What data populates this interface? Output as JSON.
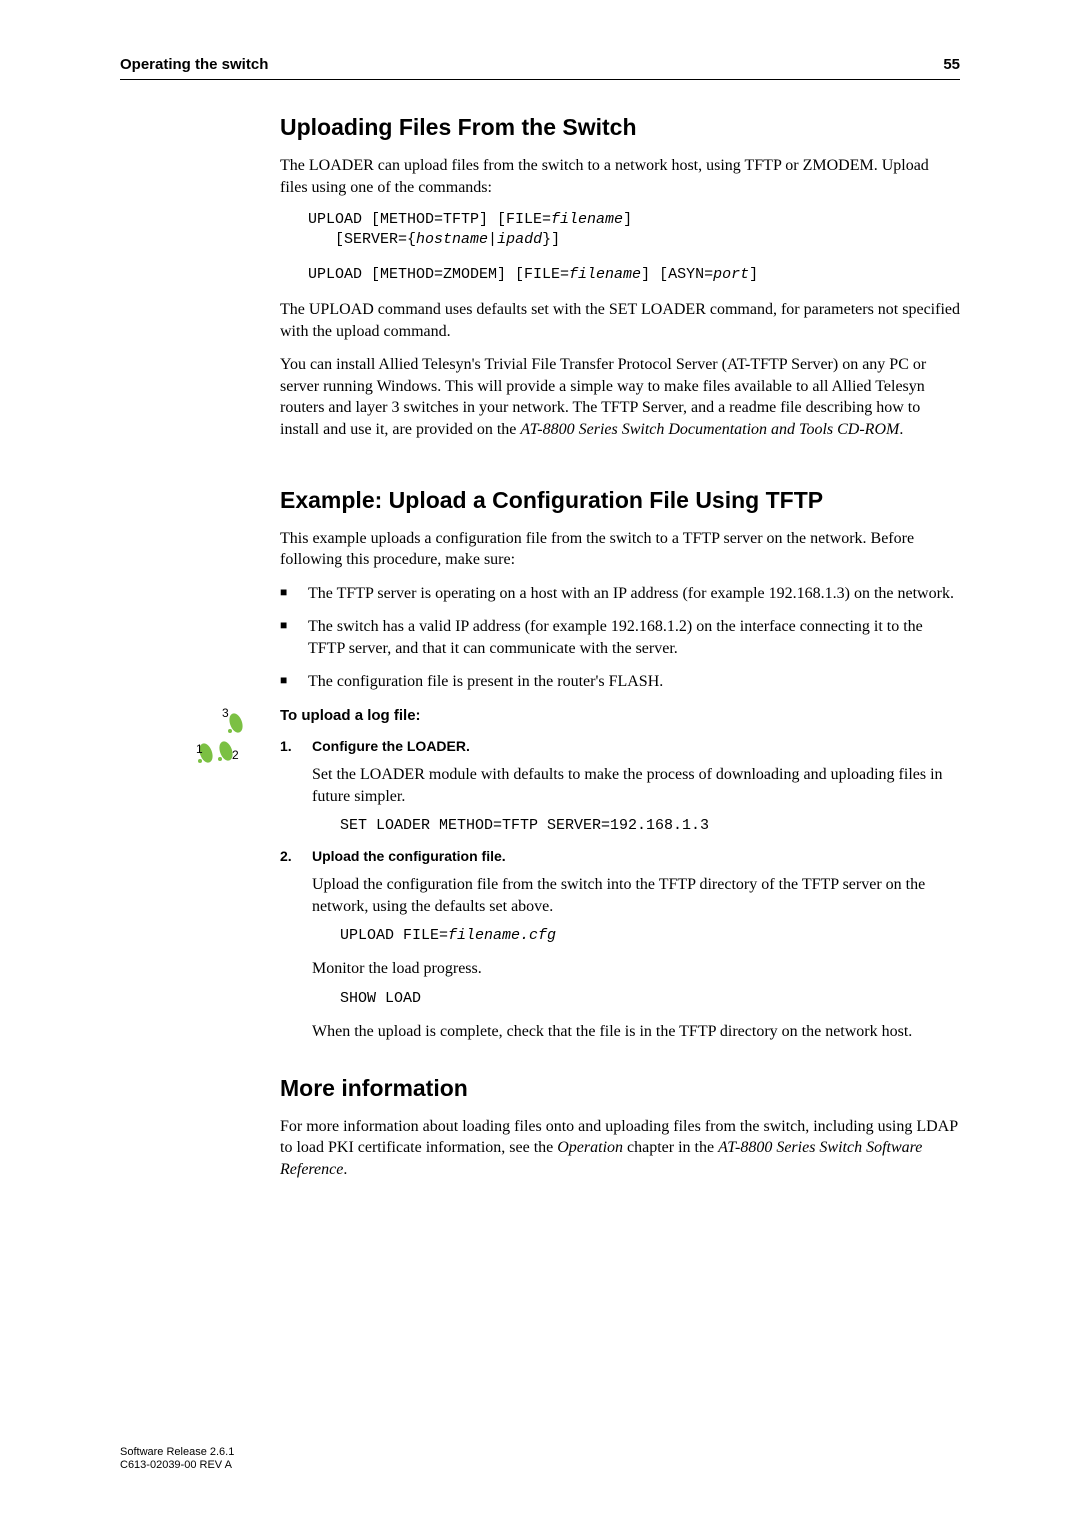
{
  "header": {
    "title": "Operating the switch",
    "page_number": "55"
  },
  "section1": {
    "heading": "Uploading Files From the Switch",
    "para1": "The LOADER can upload files from the switch to a network host, using TFTP or ZMODEM. Upload files using one of the commands:",
    "code1_a": "UPLOAD [METHOD=TFTP] [FILE=",
    "code1_b": "filename",
    "code1_c": "] \n   [SERVER={",
    "code1_d": "hostname",
    "code1_e": "|",
    "code1_f": "ipadd",
    "code1_g": "}]",
    "code2_a": "UPLOAD [METHOD=ZMODEM] [FILE=",
    "code2_b": "filename",
    "code2_c": "] [ASYN=",
    "code2_d": "port",
    "code2_e": "]",
    "para2": "The UPLOAD command uses defaults set with the SET LOADER command, for parameters not specified with the upload command.",
    "para3_a": "You can install Allied Telesyn's Trivial File Transfer Protocol Server (AT-TFTP Server) on any PC or server running Windows. This will provide a simple way to make files available to all Allied Telesyn routers and layer 3 switches in your network. The TFTP Server, and a readme file describing how to install and use it, are provided on the ",
    "para3_b": "AT-8800 Series Switch Documentation and Tools CD-ROM",
    "para3_c": "."
  },
  "section2": {
    "heading": "Example: Upload a Configuration File Using TFTP",
    "para1": "This example uploads a configuration file from the switch to a TFTP server on the network. Before following this procedure, make sure:",
    "bullets": [
      "The TFTP server is operating on a host with an IP address (for example 192.168.1.3) on the network.",
      "The switch has a valid IP address (for example 192.168.1.2) on the interface connecting it to the TFTP server, and that it can communicate with the server.",
      "The configuration file is present in the router's FLASH."
    ],
    "proc_title": "To upload a log file:",
    "step1": {
      "title": "Configure the LOADER.",
      "body": "Set the LOADER module with defaults to make the process of downloading and uploading files in future simpler.",
      "code": "SET LOADER METHOD=TFTP SERVER=192.168.1.3"
    },
    "step2": {
      "title": "Upload the configuration file.",
      "body1": "Upload the configuration file from the switch into the TFTP directory of the TFTP server on the network, using the defaults set above.",
      "code1_a": "UPLOAD FILE=",
      "code1_b": "filename.cfg",
      "body2": "Monitor the load progress.",
      "code2": "SHOW LOAD",
      "body3": "When the upload is complete, check that the file is in the TFTP directory on the network host."
    }
  },
  "section3": {
    "heading": "More information",
    "para_a": "For more information about loading files onto and uploading files from the switch, including using LDAP to load PKI certificate information, see the ",
    "para_b": "Operation",
    "para_c": " chapter in the ",
    "para_d": "AT-8800 Series Switch Software Reference",
    "para_e": "."
  },
  "footer": {
    "line1": "Software Release 2.6.1",
    "line2": "C613-02039-00 REV A"
  }
}
